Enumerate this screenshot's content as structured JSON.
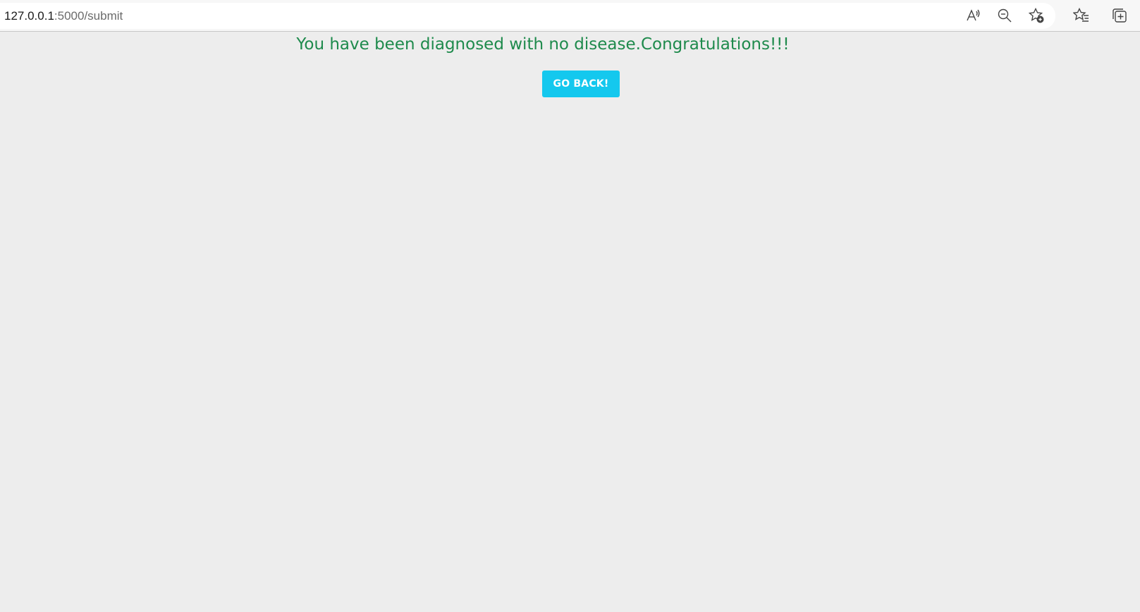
{
  "browser": {
    "url_host": "127.0.0.1",
    "url_path": ":5000/submit",
    "icons": [
      "read-aloud-icon",
      "zoom-out-icon",
      "add-favorite-icon",
      "favorites-icon",
      "collections-icon"
    ]
  },
  "main": {
    "result_message": "You have been diagnosed with no disease.Congratulations!!!",
    "go_back_label": "GO BACK!"
  },
  "colors": {
    "page_background": "#ededed",
    "result_text": "#1e8a4c",
    "button_background": "#14c8ee",
    "button_text": "#ffffff"
  }
}
